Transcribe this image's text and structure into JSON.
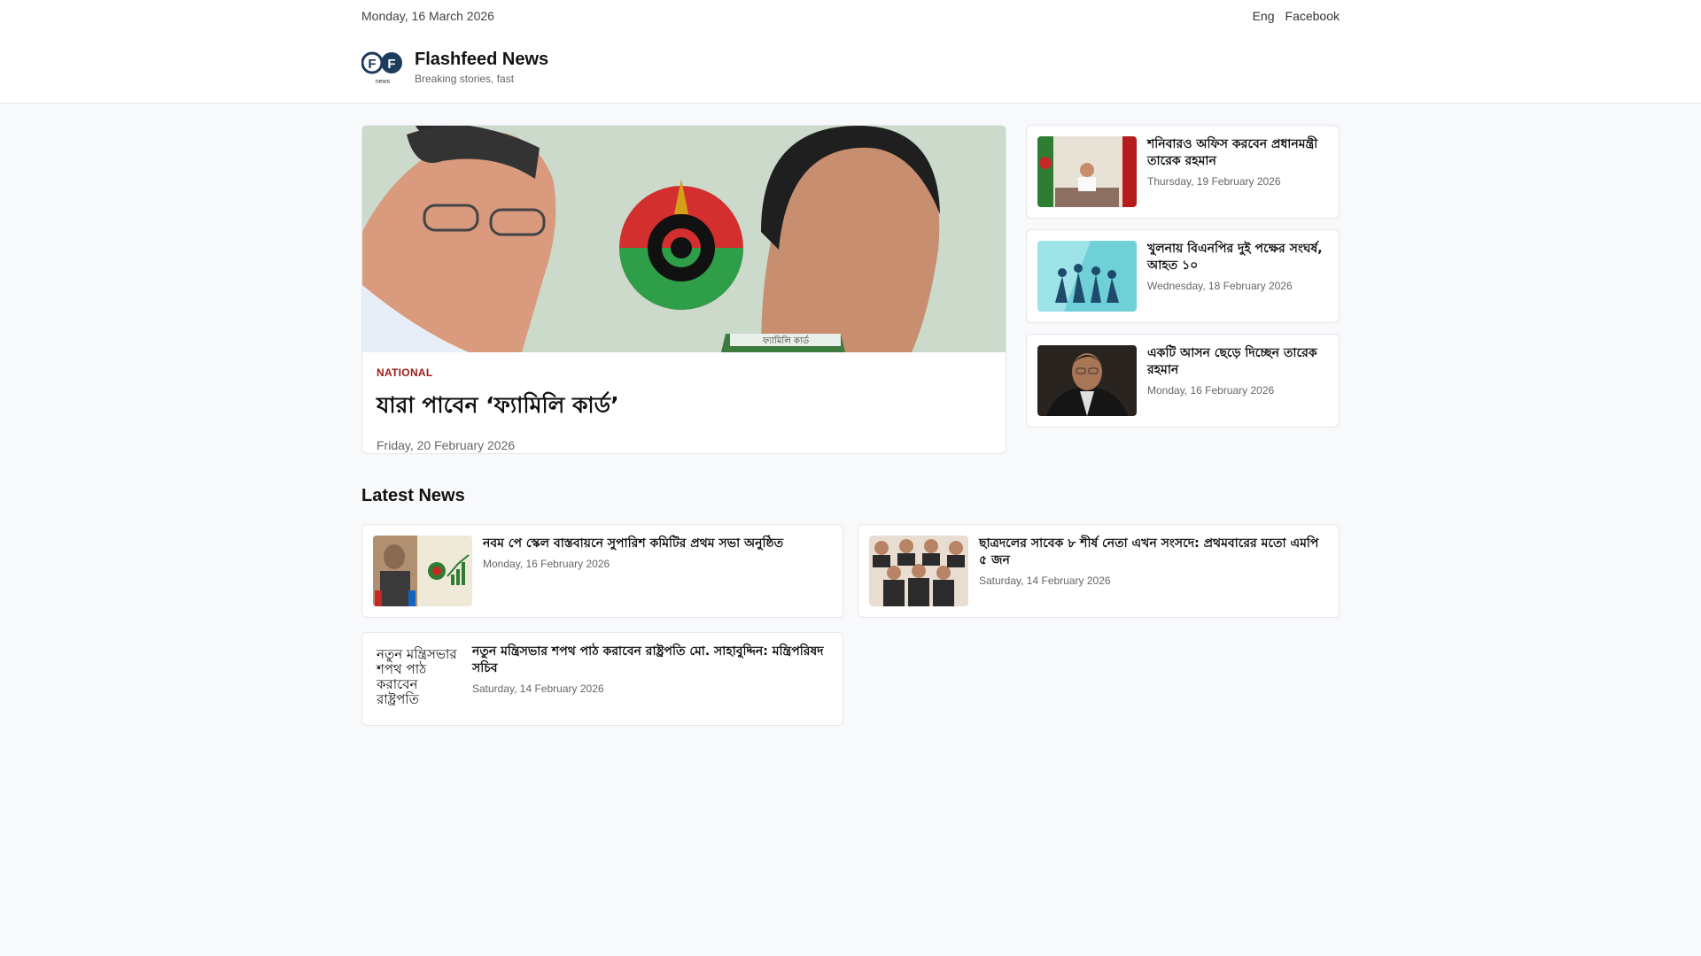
{
  "topbar": {
    "date": "Monday, 16 March 2026",
    "lang_link": "Eng",
    "facebook_link": "Facebook"
  },
  "brand": {
    "logo_letters": "FF",
    "logo_sub": "news",
    "name": "Flashfeed News",
    "tagline": "Breaking stories, fast"
  },
  "hero": {
    "category": "NATIONAL",
    "title": "যারা পাবেন ‘ফ্যামিলি কার্ড’",
    "date": "Friday, 20 February 2026",
    "image_card_text": "ফ্যামিলি কার্ড"
  },
  "side_stories": [
    {
      "title": "শনিবারও অফিস করবেন প্রধানমন্ত্রী তারেক রহমান",
      "date": "Thursday, 19 February 2026"
    },
    {
      "title": "খুলনায় বিএনপির দুই পক্ষের সংঘর্ষ, আহত ১০",
      "date": "Wednesday, 18 February 2026"
    },
    {
      "title": "একটি আসন ছেড়ে দিচ্ছেন তারেক রহমান",
      "date": "Monday, 16 February 2026"
    }
  ],
  "latest": {
    "heading": "Latest News",
    "items": [
      {
        "title": "নবম পে স্কেল বাস্তবায়নে সুপারিশ কমিটির প্রথম সভা অনুষ্ঠিত",
        "date": "Monday, 16 February 2026"
      },
      {
        "title": "ছাত্রদলের সাবেক ৮ শীর্ষ নেতা এখন সংসদে: প্রথমবারের মতো এমপি ৫ জন",
        "date": "Saturday, 14 February 2026"
      },
      {
        "title": "নতুন মন্ত্রিসভার শপথ পাঠ করাবেন রাষ্ট্রপতি মো. সাহাবুদ্দিন: মন্ত্রিপরিষদ সচিব",
        "date": "Saturday, 14 February 2026",
        "thumb_text": "নতুন মন্ত্রিসভার শপথ পাঠ করাবেন রাষ্ট্রপতি"
      }
    ]
  },
  "colors": {
    "accent": "#a11a1a",
    "logo": "#1d3b5c"
  }
}
